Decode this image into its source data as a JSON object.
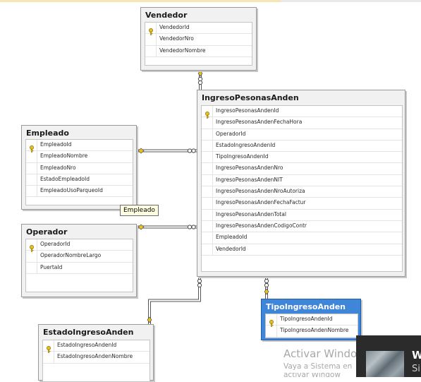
{
  "tables": {
    "vendedor": {
      "title": "Vendedor",
      "columns": [
        {
          "name": "VendedorId",
          "key": true
        },
        {
          "name": "VendedorNro",
          "key": false
        },
        {
          "name": "VendedorNombre",
          "key": false
        }
      ]
    },
    "ingreso": {
      "title": "IngresoPesonasAnden",
      "columns": [
        {
          "name": "IngresoPesonasAndenId",
          "key": true
        },
        {
          "name": "IngresoPesonasAndenFechaHora",
          "key": false
        },
        {
          "name": "OperadorId",
          "key": false
        },
        {
          "name": "EstadoIngresoAndenId",
          "key": false
        },
        {
          "name": "TipoIngresoAndenId",
          "key": false
        },
        {
          "name": "IngresoPesonasAndenNro",
          "key": false
        },
        {
          "name": "IngresoPesonasAndenNIT",
          "key": false
        },
        {
          "name": "IngresoPesonasAndenNroAutoriza",
          "key": false
        },
        {
          "name": "IngresoPesonasAndenFechaFactur",
          "key": false
        },
        {
          "name": "IngresoPesonasAndenTotal",
          "key": false
        },
        {
          "name": "IngresoPesonasAndenCodigoContr",
          "key": false
        },
        {
          "name": "EmpleadoId",
          "key": false
        },
        {
          "name": "VendedorId",
          "key": false
        }
      ]
    },
    "empleado": {
      "title": "Empleado",
      "columns": [
        {
          "name": "EmpleadoId",
          "key": true
        },
        {
          "name": "EmpleadoNombre",
          "key": false
        },
        {
          "name": "EmpleadoNro",
          "key": false
        },
        {
          "name": "EstadoEmpleadoId",
          "key": false
        },
        {
          "name": "EmpleadoUsoParqueoId",
          "key": false
        }
      ]
    },
    "operador": {
      "title": "Operador",
      "columns": [
        {
          "name": "OperadorId",
          "key": true
        },
        {
          "name": "OperadorNombreLargo",
          "key": false
        },
        {
          "name": "PuertaId",
          "key": false
        }
      ]
    },
    "tipo": {
      "title": "TipoIngresoAnden",
      "columns": [
        {
          "name": "TipoIngresoAndenId",
          "key": true
        },
        {
          "name": "TipoIngresoAndenNombre",
          "key": false
        }
      ]
    },
    "estado": {
      "title": "EstadoIngresoAnden",
      "columns": [
        {
          "name": "EstadoIngresoAndenId",
          "key": true
        },
        {
          "name": "EstadoIngresoAndenNombre",
          "key": false
        }
      ]
    }
  },
  "tooltip": "Empleado",
  "watermark": {
    "title": "Activar Windo",
    "line1": "Vaya a Sistema en",
    "line2": "activar Window"
  },
  "taskbar": {
    "big": "W",
    "small": "Si"
  },
  "colors": {
    "selected_header": "#3f86d8",
    "key_icon": "#e8c11c",
    "connector": "#555555"
  }
}
